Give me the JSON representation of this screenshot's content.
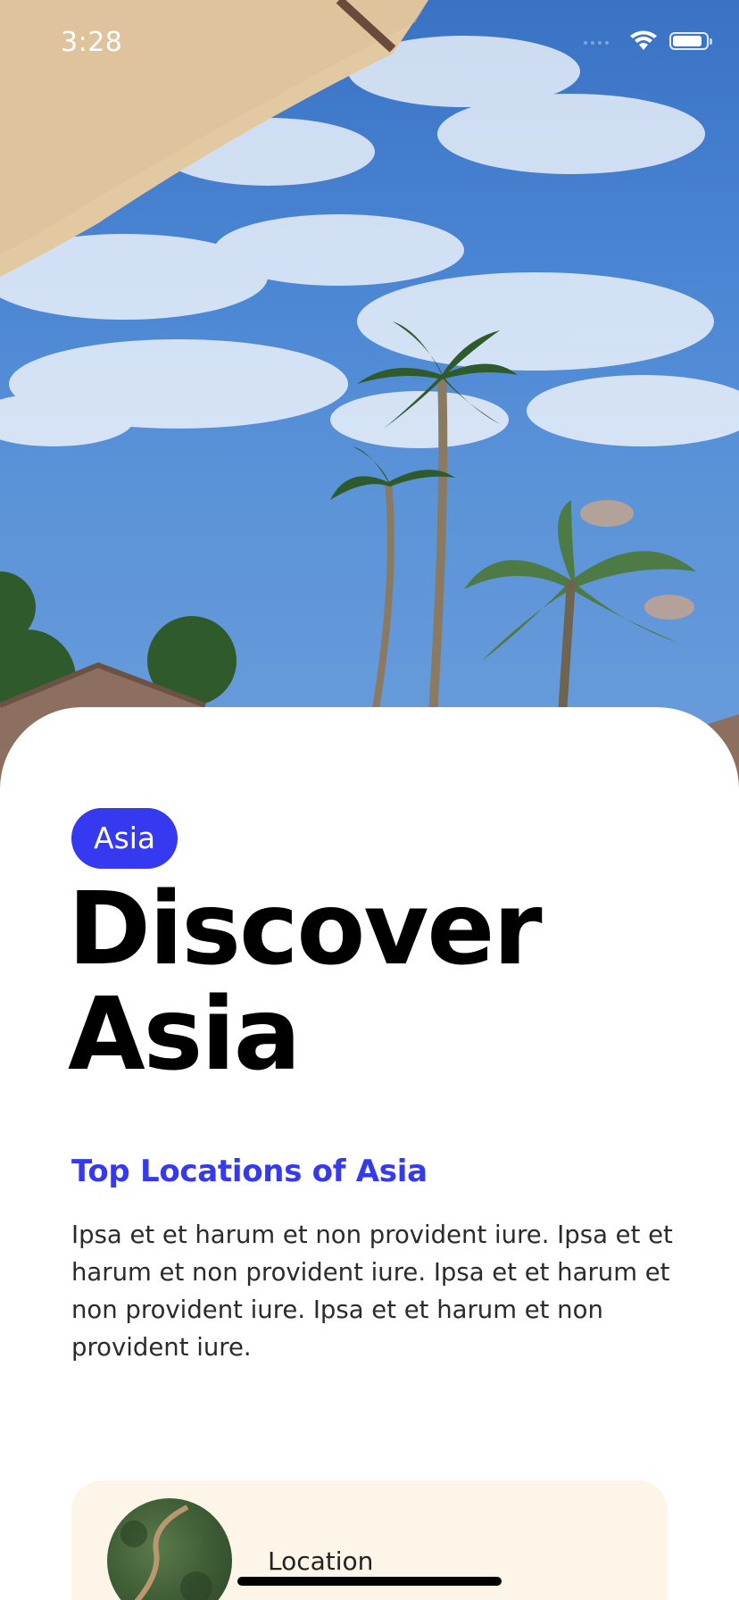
{
  "status_bar": {
    "time": "3:28",
    "icons": [
      "signal-dots-icon",
      "wifi-icon",
      "battery-icon"
    ],
    "battery_level": 0.9
  },
  "hero": {
    "image": "tropical-resort-sky-palms-photo"
  },
  "card": {
    "tag": "Asia",
    "title_line1": "Discover",
    "title_line2": "Asia",
    "subtitle": "Top Locations of Asia",
    "description": "Ipsa et et harum et non provident iure. Ipsa et et harum et non provident iure. Ipsa et et harum et non provident iure. Ipsa et et harum et non provident iure."
  },
  "location_card": {
    "label": "Location",
    "thumbnail": "forest-road-aerial-photo"
  },
  "colors": {
    "accent": "#3539f0",
    "card_background": "#ffffff",
    "location_card_background": "#fdf6e8",
    "headline": "#000000",
    "body_text": "#2b2b2b"
  }
}
